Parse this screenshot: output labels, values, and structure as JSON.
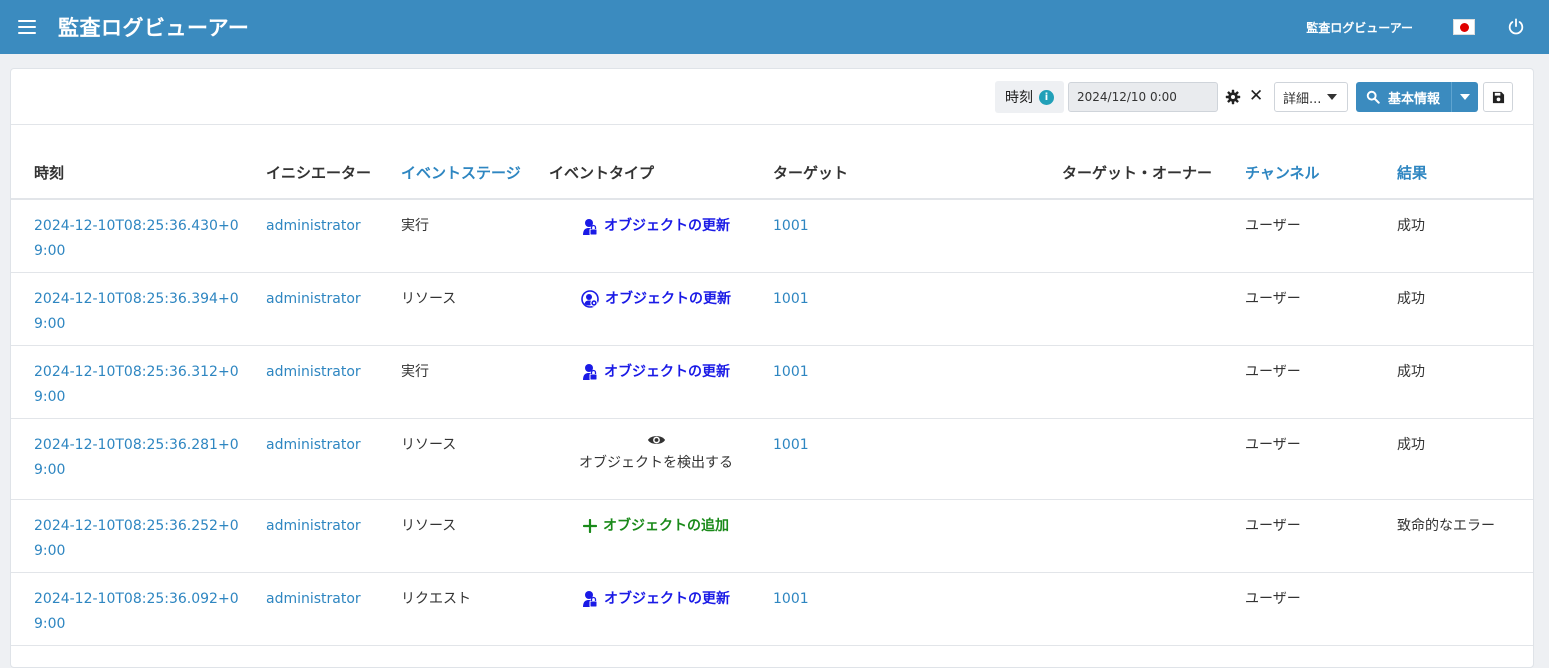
{
  "header": {
    "title": "監査ログビューアー",
    "user": "監査ログビューアー"
  },
  "toolbar": {
    "time_label": "時刻",
    "info_icon": "i",
    "date_value": "2024/12/10 0:00",
    "clear_icon": "✕",
    "detail_label": "詳細...",
    "basic_label": "基本情報"
  },
  "table": {
    "headers": {
      "time": "時刻",
      "initiator": "イニシエーター",
      "event_stage": "イベントステージ",
      "event_type": "イベントタイプ",
      "target": "ターゲット",
      "target_owner": "ターゲット・オーナー",
      "channel": "チャンネル",
      "result": "結果"
    },
    "rows": [
      {
        "time": "2024-12-10T08:25:36.430+09:00",
        "initiator": "administrator",
        "stage": "実行",
        "event_type": "オブジェクトの更新",
        "event_icon": "user-lock-icon",
        "target": "1001",
        "owner": "",
        "channel": "ユーザー",
        "result": "成功"
      },
      {
        "time": "2024-12-10T08:25:36.394+09:00",
        "initiator": "administrator",
        "stage": "リソース",
        "event_type": "オブジェクトの更新",
        "event_icon": "user-gear-icon",
        "target": "1001",
        "owner": "",
        "channel": "ユーザー",
        "result": "成功"
      },
      {
        "time": "2024-12-10T08:25:36.312+09:00",
        "initiator": "administrator",
        "stage": "実行",
        "event_type": "オブジェクトの更新",
        "event_icon": "user-lock-icon",
        "target": "1001",
        "owner": "",
        "channel": "ユーザー",
        "result": "成功"
      },
      {
        "time": "2024-12-10T08:25:36.281+09:00",
        "initiator": "administrator",
        "stage": "リソース",
        "event_type": "オブジェクトを検出する",
        "event_icon": "eye-icon",
        "target": "1001",
        "owner": "",
        "channel": "ユーザー",
        "result": "成功"
      },
      {
        "time": "2024-12-10T08:25:36.252+09:00",
        "initiator": "administrator",
        "stage": "リソース",
        "event_type": "オブジェクトの追加",
        "event_icon": "plus-icon",
        "target": "",
        "owner": "",
        "channel": "ユーザー",
        "result": "致命的なエラー"
      },
      {
        "time": "2024-12-10T08:25:36.092+09:00",
        "initiator": "administrator",
        "stage": "リクエスト",
        "event_type": "オブジェクトの更新",
        "event_icon": "user-lock-icon",
        "target": "1001",
        "owner": "",
        "channel": "ユーザー",
        "result": ""
      }
    ]
  },
  "colors": {
    "header_bg": "#3b8bbf",
    "link": "#2e86c1",
    "event_update": "#1a1ae6",
    "event_add": "#1a8a1a"
  }
}
